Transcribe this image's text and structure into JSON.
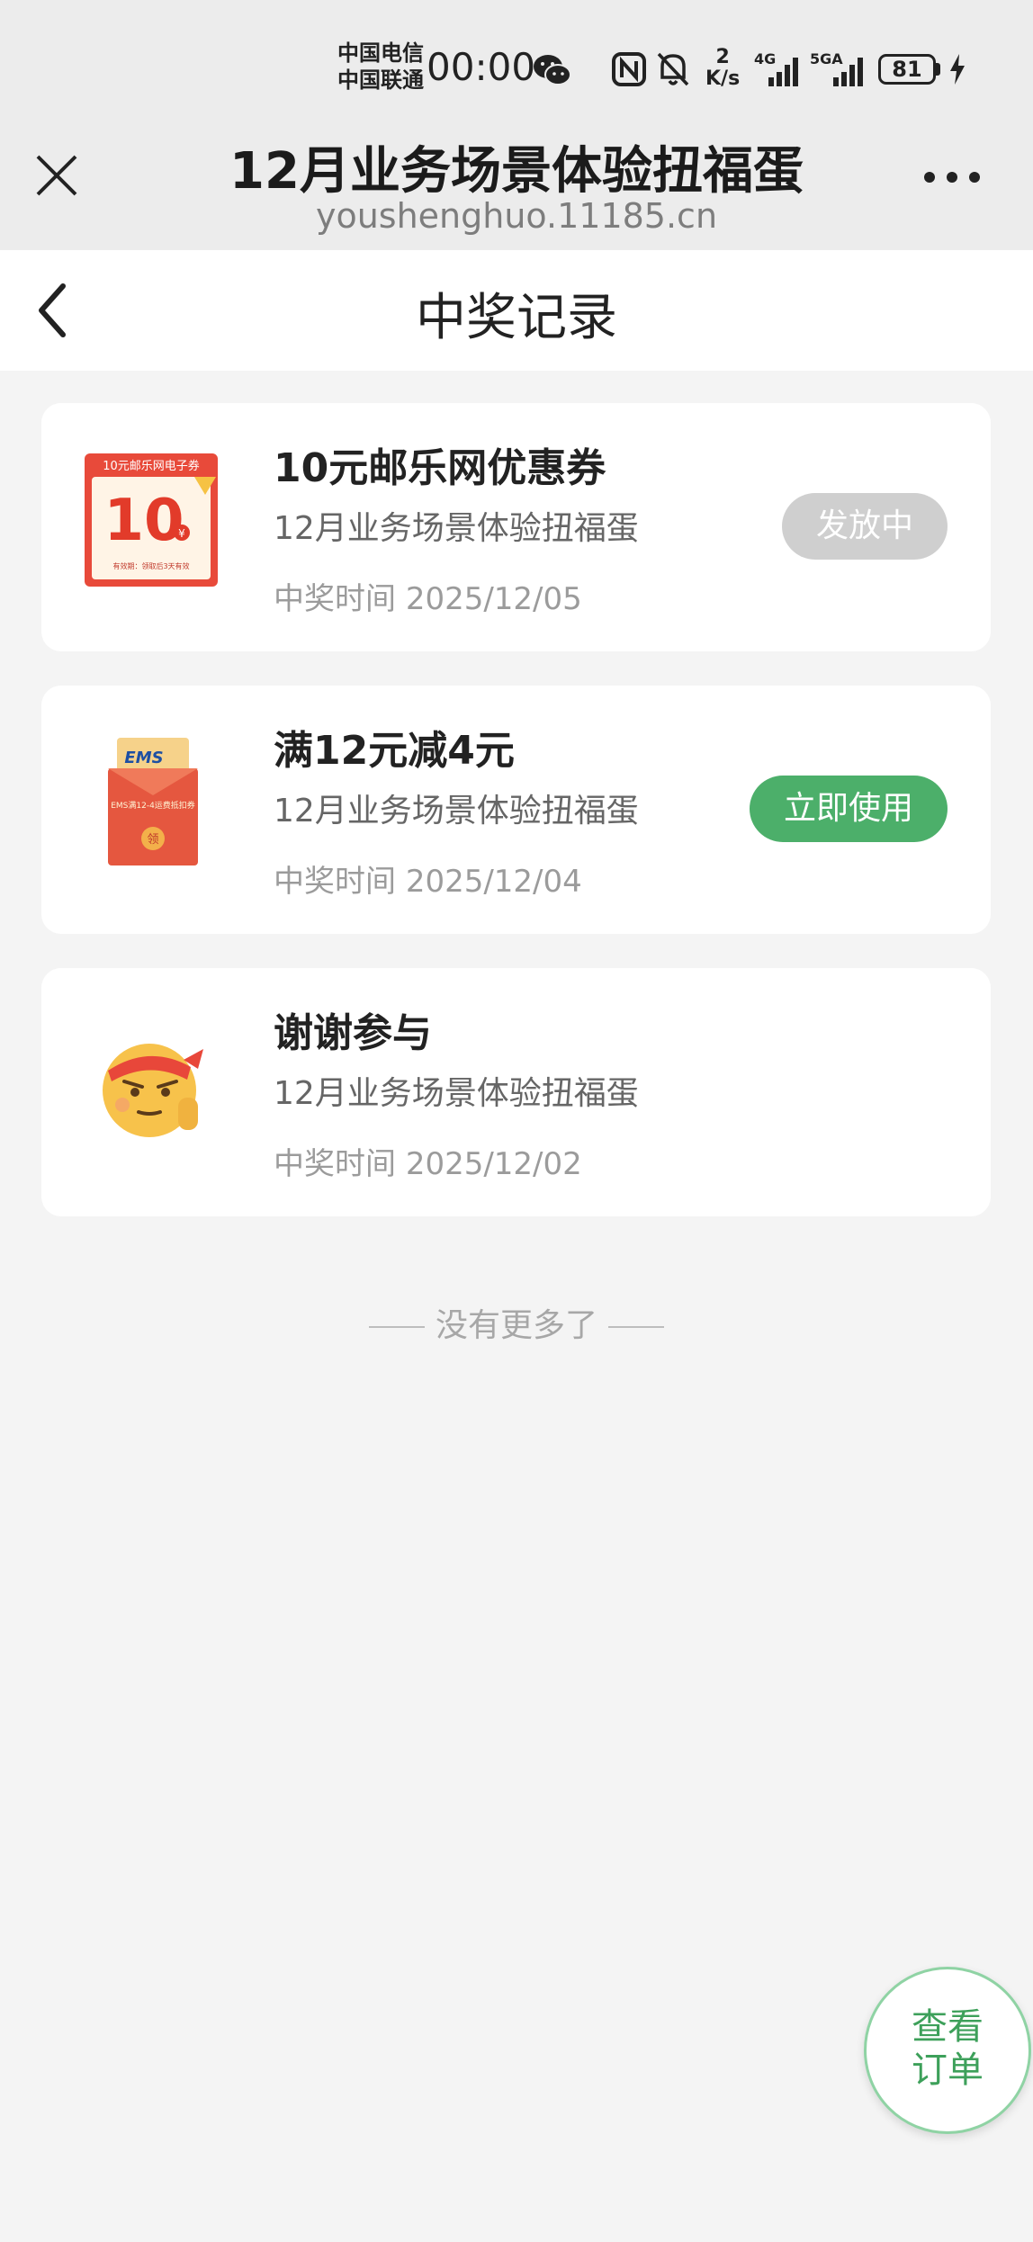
{
  "status_bar": {
    "carrier_1": "中国电信",
    "carrier_2": "中国联通",
    "time": "00:00",
    "net_speed_value": "2",
    "net_speed_unit": "K/s",
    "net_1": "4G",
    "net_2": "5GA",
    "battery": "81",
    "icons": [
      "wechat-icon",
      "nfc-icon",
      "bell-off-icon",
      "signal-icon",
      "battery-icon",
      "charging-icon"
    ]
  },
  "webview": {
    "title": "12月业务场景体验扭福蛋",
    "url": "youshenghuo.11185.cn"
  },
  "page": {
    "title": "中奖记录"
  },
  "records": [
    {
      "title": "10元邮乐网优惠券",
      "subtitle": "12月业务场景体验扭福蛋",
      "time_label": "中奖时间",
      "time_value": "2025/12/05",
      "button": "发放中",
      "image_text_top": "10元邮乐网电子券",
      "image_text_big": "10",
      "image_text_small": "有效期：领取后3天有效"
    },
    {
      "title": "满12元减4元",
      "subtitle": "12月业务场景体验扭福蛋",
      "time_label": "中奖时间",
      "time_value": "2025/12/04",
      "button": "立即使用",
      "image_text_top": "EMS",
      "image_text_mid": "EMS满12-4运费抵扣券",
      "image_text_seal": "领"
    },
    {
      "title": "谢谢参与",
      "subtitle": "12月业务场景体验扭福蛋",
      "time_label": "中奖时间",
      "time_value": "2025/12/02"
    }
  ],
  "footer_note": "没有更多了",
  "fab": {
    "line1": "查看",
    "line2": "订单"
  },
  "colors": {
    "accent_green": "#4caf6a",
    "disabled_grey": "#cfcfcf",
    "background": "#f4f4f4"
  }
}
